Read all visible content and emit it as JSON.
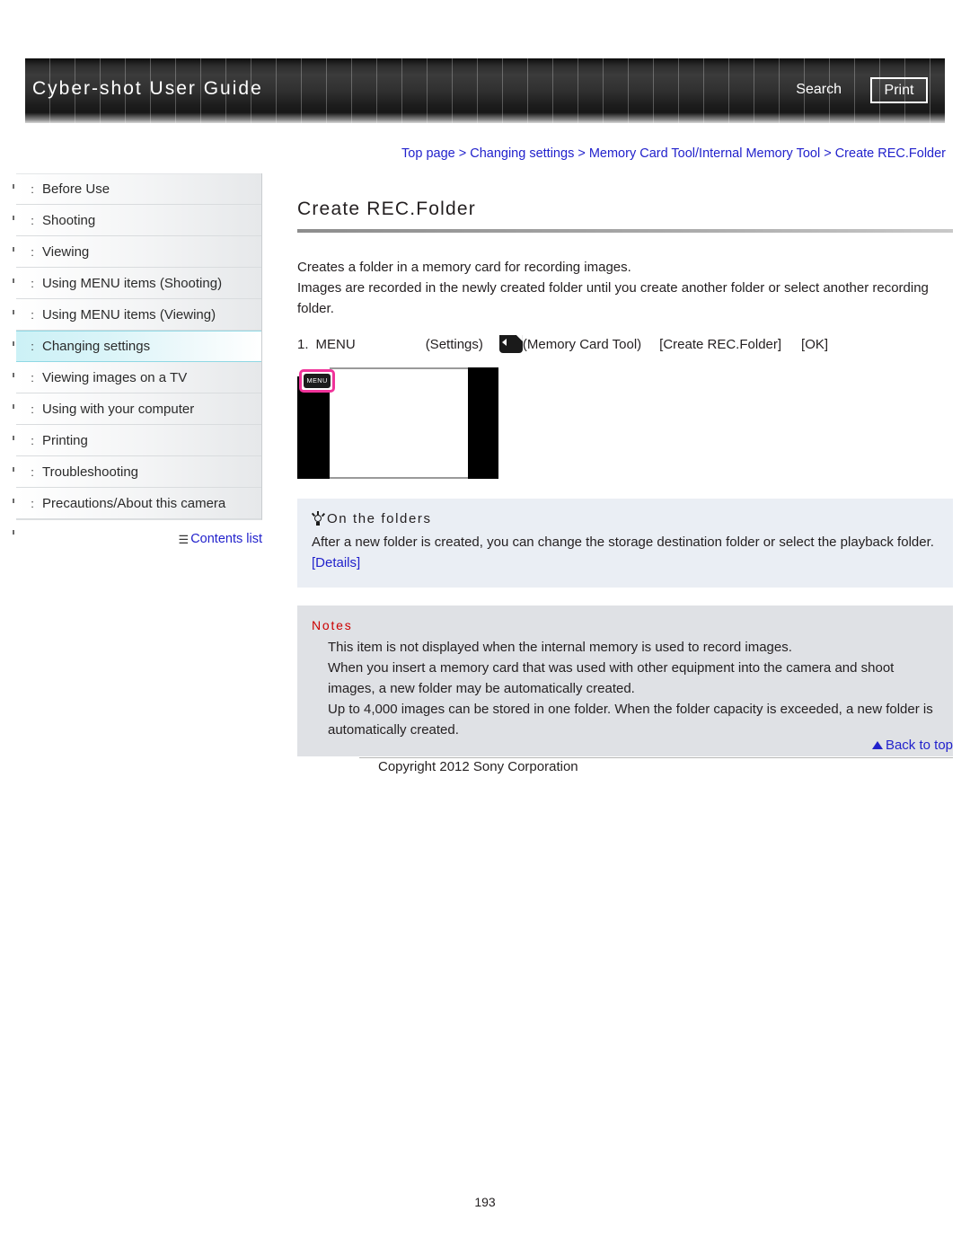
{
  "header": {
    "title": "Cyber-shot User Guide",
    "search_label": "Search",
    "print_label": "Print"
  },
  "breadcrumb": {
    "items": [
      "Top page",
      "Changing settings",
      "Memory Card Tool/Internal Memory Tool",
      "Create REC.Folder"
    ],
    "separator": ">",
    "full_text": "Top page > Changing settings > Memory Card Tool/Internal Memory Tool > Create REC.Folder"
  },
  "sidebar": {
    "items": [
      {
        "label": "Before Use",
        "active": false
      },
      {
        "label": "Shooting",
        "active": false
      },
      {
        "label": "Viewing",
        "active": false
      },
      {
        "label": "Using MENU items (Shooting)",
        "active": false
      },
      {
        "label": "Using MENU items (Viewing)",
        "active": false
      },
      {
        "label": "Changing settings",
        "active": true
      },
      {
        "label": "Viewing images on a TV",
        "active": false
      },
      {
        "label": "Using with your computer",
        "active": false
      },
      {
        "label": "Printing",
        "active": false
      },
      {
        "label": "Troubleshooting",
        "active": false
      },
      {
        "label": "Precautions/About this camera",
        "active": false
      }
    ],
    "bullet": ":",
    "contents_list_label": "Contents list",
    "contents_list_icon": "☰"
  },
  "main": {
    "page_title": "Create REC.Folder",
    "paragraphs": [
      "Creates a folder in a memory card for recording images.",
      "Images are recorded in the newly created folder until you create another folder or select another recording folder."
    ],
    "step": {
      "number": "1.",
      "menu_label": "MENU",
      "settings_label": "(Settings)",
      "card_icon_name": "memory-card-icon",
      "memory_card_tool_label": "(Memory Card Tool)",
      "create_rec_folder_label": "[Create REC.Folder]",
      "ok_label": "[OK]"
    },
    "figure": {
      "menu_button_label": "MENU",
      "highlight_color": "#f0339a"
    },
    "tip": {
      "icon": "lightbulb-icon",
      "heading": "On the folders",
      "text": "After a new folder is created, you can change the storage destination folder or select the playback folder.",
      "link_label": "[Details]"
    },
    "notes": {
      "heading": "Notes",
      "items": [
        "This item is not displayed when the internal memory is used to record images.",
        "When you insert a memory card that was used with other equipment into the camera and shoot images, a new folder may be automatically created.",
        "Up to 4,000 images can be stored in one folder. When the folder capacity is exceeded, a new folder is automatically created."
      ]
    }
  },
  "footer": {
    "back_to_top_label": "Back to top",
    "copyright": "Copyright 2012 Sony Corporation",
    "page_number": "193"
  },
  "colors": {
    "link": "#2222cc",
    "notes_heading": "#cc0000",
    "tip_background": "#eaeef4",
    "notes_background": "#dfe1e5",
    "sidebar_active": "#ccf1f6",
    "banner": "#303030"
  }
}
